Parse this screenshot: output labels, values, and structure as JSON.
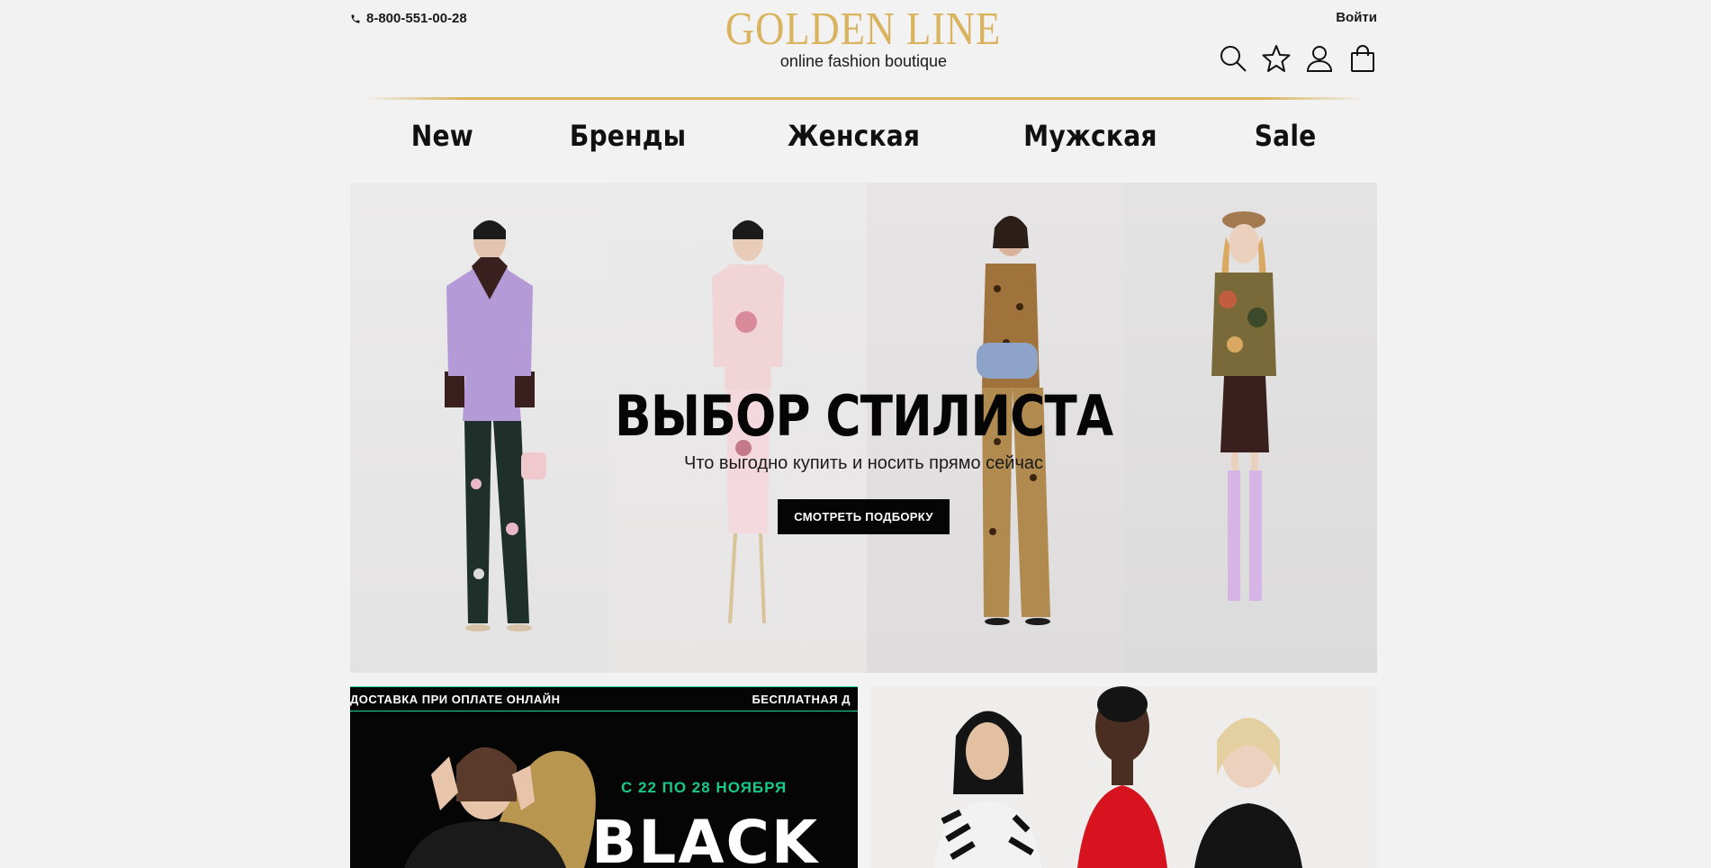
{
  "header": {
    "phone": "8-800-551-00-28",
    "logo_title": "GOLDEN LINE",
    "logo_subtitle": "online fashion boutique",
    "login_label": "Войти"
  },
  "nav": {
    "items": [
      "New",
      "Бренды",
      "Женская",
      "Мужская",
      "Sale"
    ]
  },
  "hero": {
    "title": "ВЫБОР СТИЛИСТА",
    "subtitle": "Что выгодно купить и носить прямо сейчас",
    "button_label": "СМОТРЕТЬ ПОДБОРКУ"
  },
  "promo_left": {
    "ticker_left": "ДОСТАВКА ПРИ ОПЛАТЕ ОНЛАЙН",
    "ticker_right": "БЕСПЛАТНАЯ Д",
    "date_text": "С 22 ПО 28 НОЯБРЯ",
    "headline": "BLACK"
  },
  "colors": {
    "gold": "#d9b35e",
    "accent_green": "#18c98a",
    "background": "#f2f2f2"
  }
}
